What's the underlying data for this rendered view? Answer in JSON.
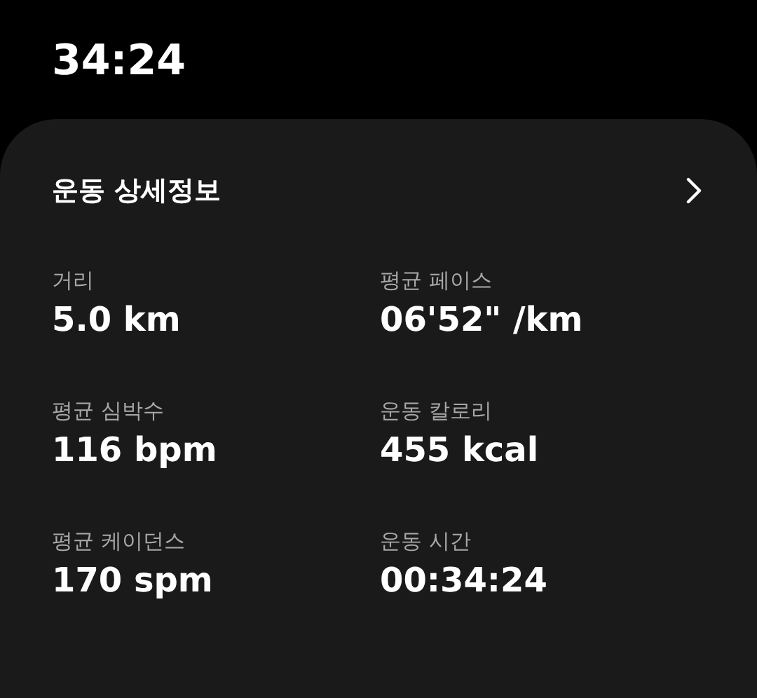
{
  "header": {
    "time": "34:24"
  },
  "card": {
    "title": "운동 상세정보",
    "stats": [
      {
        "label": "거리",
        "value": "5.0 km"
      },
      {
        "label": "평균 페이스",
        "value": "06'52\" /km"
      },
      {
        "label": "평균 심박수",
        "value": "116 bpm"
      },
      {
        "label": "운동 칼로리",
        "value": "455 kcal"
      },
      {
        "label": "평균 케이던스",
        "value": "170 spm"
      },
      {
        "label": "운동 시간",
        "value": "00:34:24"
      }
    ]
  }
}
